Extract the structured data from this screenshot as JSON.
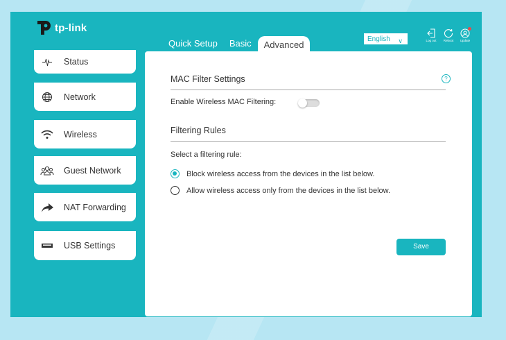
{
  "brand": {
    "logo_text": "tp-link"
  },
  "tabs": [
    {
      "label": "Quick Setup"
    },
    {
      "label": "Basic"
    },
    {
      "label": "Advanced"
    }
  ],
  "language": {
    "selected": "English"
  },
  "top_actions": [
    {
      "label": "Log out",
      "icon": "logout-icon"
    },
    {
      "label": "Reboot",
      "icon": "reboot-icon"
    },
    {
      "label": "Update",
      "icon": "update-icon"
    }
  ],
  "sidebar": {
    "items": [
      {
        "label": "Status",
        "icon": "pulse-icon"
      },
      {
        "label": "Network",
        "icon": "globe-icon"
      },
      {
        "label": "Wireless",
        "icon": "wifi-icon"
      },
      {
        "label": "Guest Network",
        "icon": "users-icon"
      },
      {
        "label": "NAT Forwarding",
        "icon": "forward-arrow-icon"
      },
      {
        "label": "USB Settings",
        "icon": "usb-icon"
      }
    ]
  },
  "main": {
    "mac_filter_title": "MAC Filter Settings",
    "help_symbol": "?",
    "enable_label": "Enable Wireless MAC Filtering:",
    "enable_state": false,
    "filtering_rules_title": "Filtering Rules",
    "select_rule_label": "Select a filtering rule:",
    "rules": [
      {
        "label": "Block wireless access from the devices in the list below.",
        "checked": true
      },
      {
        "label": "Allow wireless access only from the devices in the list below.",
        "checked": false
      }
    ],
    "save_label": "Save"
  },
  "colors": {
    "accent": "#19b5bf",
    "background": "#b7e6f3",
    "notification": "#e84b4b"
  }
}
